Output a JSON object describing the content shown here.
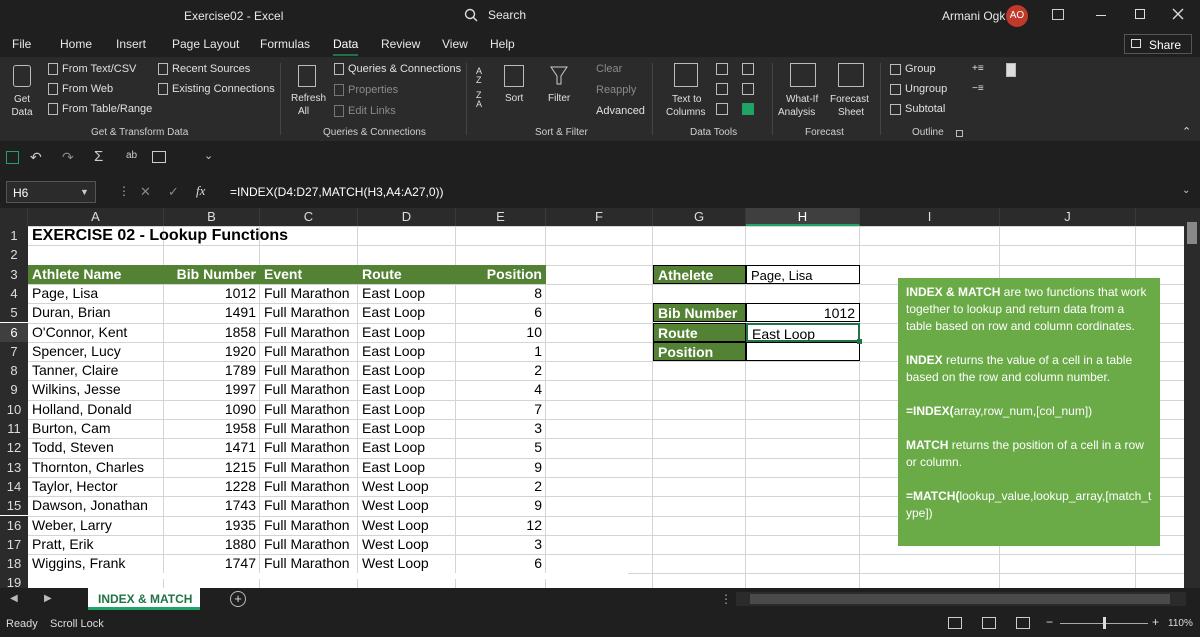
{
  "window": {
    "title": "Exercise02  -  Excel",
    "search": "Search",
    "user": "Armani Ogk",
    "initials": "AO"
  },
  "menu": [
    "File",
    "Home",
    "Insert",
    "Page Layout",
    "Formulas",
    "Data",
    "Review",
    "View",
    "Help"
  ],
  "share": "Share",
  "ribbon": {
    "get_data": "Get\nData",
    "from_text": "From Text/CSV",
    "from_web": "From Web",
    "from_table": "From Table/Range",
    "recent": "Recent Sources",
    "existing": "Existing Connections",
    "g1": "Get & Transform Data",
    "refresh": "Refresh",
    "refresh_all": "All",
    "queries": "Queries & Connections",
    "properties": "Properties",
    "edit_links": "Edit Links",
    "g2": "Queries & Connections",
    "sort": "Sort",
    "filter": "Filter",
    "clear": "Clear",
    "reapply": "Reapply",
    "advanced": "Advanced",
    "g3": "Sort & Filter",
    "text_to_columns_1": "Text to",
    "text_to_columns_2": "Columns",
    "g4": "Data Tools",
    "whatif_1": "What-If",
    "whatif_2": "Analysis",
    "forecast_1": "Forecast",
    "forecast_2": "Sheet",
    "g5": "Forecast",
    "group": "Group",
    "ungroup": "Ungroup",
    "subtotal": "Subtotal",
    "g6": "Outline"
  },
  "namebox": "H6",
  "formula": "=INDEX(D4:D27,MATCH(H3,A4:A27,0))",
  "columns": [
    "A",
    "B",
    "C",
    "D",
    "E",
    "F",
    "G",
    "H",
    "I",
    "J"
  ],
  "title_cell": "EXERCISE 02 - Lookup Functions",
  "headers": [
    "Athlete Name",
    "Bib Number",
    "Event",
    "Route",
    "Position"
  ],
  "rows": [
    [
      "Page, Lisa",
      "1012",
      "Full Marathon",
      "East Loop",
      "8"
    ],
    [
      "Duran, Brian",
      "1491",
      "Full Marathon",
      "East Loop",
      "6"
    ],
    [
      "O'Connor, Kent",
      "1858",
      "Full Marathon",
      "East Loop",
      "10"
    ],
    [
      "Spencer, Lucy",
      "1920",
      "Full Marathon",
      "East Loop",
      "1"
    ],
    [
      "Tanner, Claire",
      "1789",
      "Full Marathon",
      "East Loop",
      "2"
    ],
    [
      "Wilkins, Jesse",
      "1997",
      "Full Marathon",
      "East Loop",
      "4"
    ],
    [
      "Holland, Donald",
      "1090",
      "Full Marathon",
      "East Loop",
      "7"
    ],
    [
      "Burton, Cam",
      "1958",
      "Full Marathon",
      "East Loop",
      "3"
    ],
    [
      "Todd, Steven",
      "1471",
      "Full Marathon",
      "East Loop",
      "5"
    ],
    [
      "Thornton, Charles",
      "1215",
      "Full Marathon",
      "East Loop",
      "9"
    ],
    [
      "Taylor, Hector",
      "1228",
      "Full Marathon",
      "West Loop",
      "2"
    ],
    [
      "Dawson, Jonathan",
      "1743",
      "Full Marathon",
      "West Loop",
      "9"
    ],
    [
      "Weber, Larry",
      "1935",
      "Full Marathon",
      "West Loop",
      "12"
    ],
    [
      "Pratt, Erik",
      "1880",
      "Full Marathon",
      "West Loop",
      "3"
    ],
    [
      "Wiggins, Frank",
      "1747",
      "Full Marathon",
      "West Loop",
      "6"
    ]
  ],
  "lookup": {
    "athlete_label": "Athelete",
    "athlete_value": "Page, Lisa",
    "bib_label": "Bib Number",
    "bib_value": "1012",
    "route_label": "Route",
    "route_value": "East Loop",
    "position_label": "Position",
    "position_value": ""
  },
  "info": {
    "p1_bold": "INDEX & MATCH",
    "p1": " are two functions that work together to lookup and return data from a table based on row and column cordinates.",
    "p2_bold": "INDEX",
    "p2": " returns the value of a cell in a table based on the row and column number.",
    "p3_bold": "=INDEX(",
    "p3": "array,row_num,[col_num])",
    "p4_bold": "MATCH",
    "p4": " returns the position of a cell in a row or column.",
    "p5_bold": "=MATCH(",
    "p5": "lookup_value,lookup_array,[match_type])"
  },
  "sheet_tab": "INDEX & MATCH",
  "status": {
    "ready": "Ready",
    "scroll": "Scroll Lock",
    "zoom": "110%"
  },
  "colors": {
    "accent": "#217346",
    "header_green": "#548235",
    "info_green": "#6aab47"
  }
}
